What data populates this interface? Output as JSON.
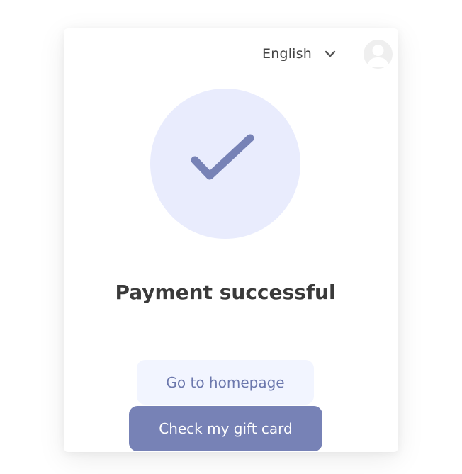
{
  "header": {
    "language_label": "English",
    "language_icon": "chevron-down-icon",
    "avatar_icon": "user-avatar-icon"
  },
  "main": {
    "status_icon": "check-icon",
    "title": "Payment successful"
  },
  "actions": {
    "homepage_label": "Go to homepage",
    "gift_card_label": "Check my gift card"
  },
  "colors": {
    "accent": "#7782b6",
    "accent_light": "#e9ecfd",
    "button_light": "#f2f5ff",
    "text_dark": "#3a3a3a"
  }
}
